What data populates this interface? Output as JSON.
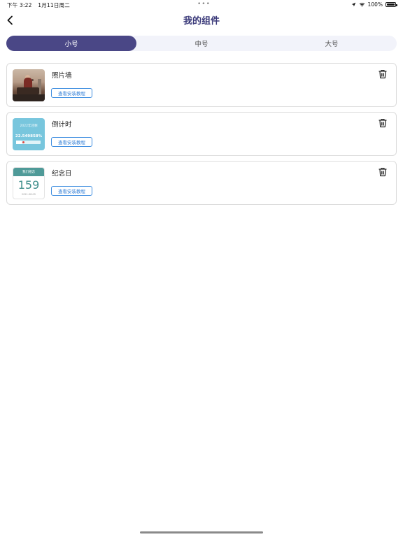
{
  "status_bar": {
    "time": "下午 3:22",
    "date": "1月11日周二",
    "battery": "100%"
  },
  "nav": {
    "title": "我的组件",
    "back_icon": "chevron-left-icon"
  },
  "tabs": [
    {
      "label": "小号",
      "active": true
    },
    {
      "label": "中号",
      "active": false
    },
    {
      "label": "大号",
      "active": false
    }
  ],
  "widgets": [
    {
      "title": "照片墙",
      "button_label": "查看安装教程",
      "thumb": "photo-wall-thumbnail"
    },
    {
      "title": "倒计时",
      "button_label": "查看安装教程",
      "thumb": "countdown-thumbnail",
      "preview_label": "2022年还剩",
      "preview_value": "22.549858%",
      "preview_progress": 0.22
    },
    {
      "title": "纪念日",
      "button_label": "查看安装教程",
      "thumb": "anniversary-thumbnail",
      "preview_header": "我们相恋",
      "preview_days": "159",
      "preview_date": "2021.08.05"
    }
  ],
  "colors": {
    "accent": "#4a4786",
    "title": "#3b3a7a",
    "button_border": "#3f8ee0",
    "countdown_bg": "#78c6dd",
    "anniversary_header": "#4f9a98"
  }
}
